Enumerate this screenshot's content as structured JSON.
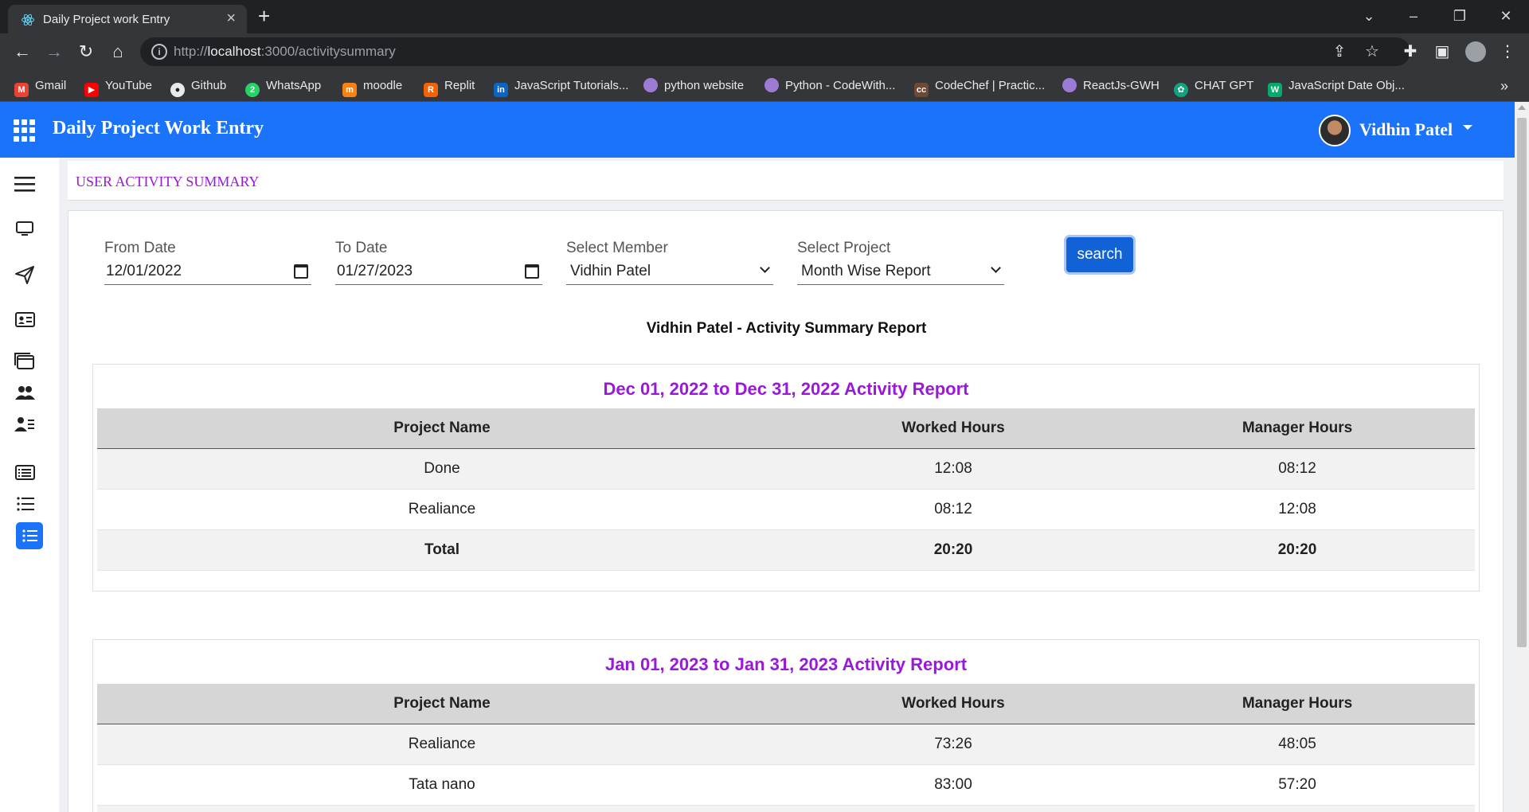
{
  "browser": {
    "tab_title": "Daily Project work Entry",
    "url_prefix": "http://",
    "url_host": "localhost",
    "url_rest": ":3000/activitysummary",
    "bookmarks": [
      {
        "label": "Gmail",
        "icon": "gmail-icon",
        "color": "#ea4335"
      },
      {
        "label": "YouTube",
        "icon": "youtube-icon",
        "color": "#ff0000"
      },
      {
        "label": "Github",
        "icon": "github-icon",
        "color": "#e8eaed"
      },
      {
        "label": "WhatsApp",
        "icon": "whatsapp-icon",
        "color": "#25d366"
      },
      {
        "label": "moodle",
        "icon": "moodle-icon",
        "color": "#f98012"
      },
      {
        "label": "Replit",
        "icon": "replit-icon",
        "color": "#f26207"
      },
      {
        "label": "JavaScript Tutorials...",
        "icon": "linkedin-icon",
        "color": "#0a66c2"
      },
      {
        "label": "python website",
        "icon": "python-site-icon",
        "color": "#9b7bd4"
      },
      {
        "label": "Python - CodeWith...",
        "icon": "codewithharry-icon",
        "color": "#9b7bd4"
      },
      {
        "label": "CodeChef | Practic...",
        "icon": "codechef-icon",
        "color": "#6e4a35"
      },
      {
        "label": "ReactJs-GWH",
        "icon": "react-gwh-icon",
        "color": "#9b7bd4"
      },
      {
        "label": "CHAT GPT",
        "icon": "chatgpt-icon",
        "color": "#10a37f"
      },
      {
        "label": "JavaScript Date Obj...",
        "icon": "w3schools-icon",
        "color": "#04aa6d"
      }
    ]
  },
  "header": {
    "app_title": "Daily Project Work Entry",
    "user_name": "Vidhin Patel",
    "accent": "#1a73f8"
  },
  "page": {
    "title": "USER ACTIVITY SUMMARY",
    "title_color": "#9a19d8"
  },
  "filters": {
    "from_date": {
      "label": "From Date",
      "value": "12/01/2022"
    },
    "to_date": {
      "label": "To Date",
      "value": "01/27/2023"
    },
    "member": {
      "label": "Select Member",
      "value": "Vidhin Patel"
    },
    "project": {
      "label": "Select Project",
      "value": "Month Wise Report"
    },
    "search_label": "search"
  },
  "report": {
    "heading": "Vidhin Patel - Activity Summary Report",
    "columns": [
      "Project Name",
      "Worked Hours",
      "Manager Hours"
    ],
    "sections": [
      {
        "title": "Dec 01, 2022 to Dec 31, 2022 Activity Report",
        "rows": [
          [
            "Done",
            "12:08",
            "08:12"
          ],
          [
            "Realiance",
            "08:12",
            "12:08"
          ]
        ],
        "total": [
          "Total",
          "20:20",
          "20:20"
        ]
      },
      {
        "title": "Jan 01, 2023 to Jan 31, 2023 Activity Report",
        "rows": [
          [
            "Realiance",
            "73:26",
            "48:05"
          ],
          [
            "Tata nano",
            "83:00",
            "57:20"
          ]
        ]
      }
    ]
  }
}
